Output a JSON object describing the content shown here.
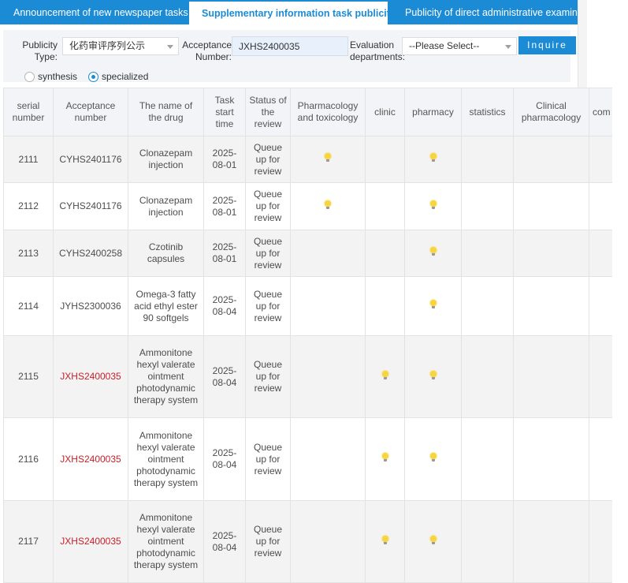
{
  "tabs": [
    {
      "label": "Announcement of new newspaper tasks",
      "active": false
    },
    {
      "label": "Supplementary information task publicity",
      "active": true
    },
    {
      "label": "Publicity of direct administrative examination and a",
      "active": false
    }
  ],
  "filters": {
    "publicity_type_label": "Publicity Type:",
    "publicity_type_value": "化药审评序列公示",
    "acceptance_label": "Acceptance Number:",
    "acceptance_value": "JXHS2400035",
    "evaluation_label": "Evaluation departments:",
    "evaluation_value": "--Please Select--",
    "inquire_label": "Inquire",
    "radio_synthesis": "synthesis",
    "radio_specialized": "specialized",
    "selected_radio": "specialized"
  },
  "table": {
    "headers": [
      "serial number",
      "Acceptance number",
      "The name of the drug",
      "Task start time",
      "Status of the review",
      "Pharmacology and toxicology",
      "clinic",
      "pharmacy",
      "statistics",
      "Clinical pharmacology",
      "com"
    ],
    "rows": [
      {
        "serial": "2111",
        "acceptance": "CYHS2401176",
        "drug": "Clonazepam injection",
        "start": "2025-08-01",
        "status": "Queue up for review",
        "highlight": false,
        "pharmacology": true,
        "clinic": false,
        "pharmacy": true
      },
      {
        "serial": "2112",
        "acceptance": "CYHS2401176",
        "drug": "Clonazepam injection",
        "start": "2025-08-01",
        "status": "Queue up for review",
        "highlight": false,
        "pharmacology": true,
        "clinic": false,
        "pharmacy": true
      },
      {
        "serial": "2113",
        "acceptance": "CYHS2400258",
        "drug": "Czotinib capsules",
        "start": "2025-08-01",
        "status": "Queue up for review",
        "highlight": false,
        "pharmacology": false,
        "clinic": false,
        "pharmacy": true
      },
      {
        "serial": "2114",
        "acceptance": "JYHS2300036",
        "drug": "Omega-3 fatty acid ethyl ester 90 softgels",
        "start": "2025-08-04",
        "status": "Queue up for review",
        "highlight": false,
        "pharmacology": false,
        "clinic": false,
        "pharmacy": true
      },
      {
        "serial": "2115",
        "acceptance": "JXHS2400035",
        "drug": "Ammonitone hexyl valerate ointment photodynamic therapy system",
        "start": "2025-08-04",
        "status": "Queue up for review",
        "highlight": true,
        "pharmacology": false,
        "clinic": true,
        "pharmacy": true
      },
      {
        "serial": "2116",
        "acceptance": "JXHS2400035",
        "drug": "Ammonitone hexyl valerate ointment photodynamic therapy system",
        "start": "2025-08-04",
        "status": "Queue up for review",
        "highlight": true,
        "pharmacology": false,
        "clinic": true,
        "pharmacy": true
      },
      {
        "serial": "2117",
        "acceptance": "JXHS2400035",
        "drug": "Ammonitone hexyl valerate ointment photodynamic therapy system",
        "start": "2025-08-04",
        "status": "Queue up for review",
        "highlight": true,
        "pharmacology": false,
        "clinic": true,
        "pharmacy": true
      }
    ]
  },
  "icons": {
    "review_marker": "lightbulb-icon"
  },
  "colors": {
    "accent": "#1c8bd6",
    "highlight_text": "#c8202a",
    "bulb": "#f7d441"
  }
}
